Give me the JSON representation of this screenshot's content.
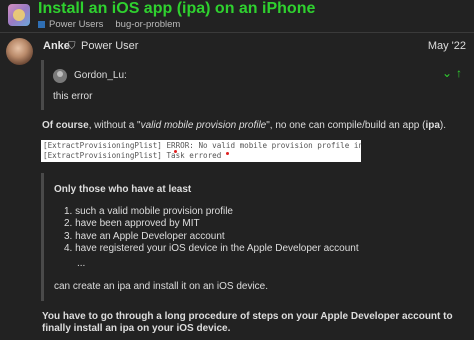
{
  "topic": {
    "title": "Install an iOS app (ipa) on an iPhone",
    "category": "Power Users",
    "tag": "bug-or-problem"
  },
  "post": {
    "author": "Anke",
    "author_title": "Power User",
    "date": "May '22",
    "quote": {
      "user": "Gordon_Lu:",
      "text": "this error",
      "icons": [
        "chevron-down-icon",
        "arrow-up-icon"
      ]
    },
    "para1": {
      "bold_lead": "Of course",
      "text_a": ", without a \"",
      "italic": "valid mobile provision profile",
      "text_b": "\", no one can compile/build an app (",
      "bold_ipa": "ipa",
      "text_c": ")."
    },
    "code_lines": [
      "[ExtractProvisioningPlist] ERROR: No valid mobile provision profile included in project",
      "[ExtractProvisioningPlist] Task errored"
    ],
    "quote2": {
      "title": "Only those who have at least",
      "items": [
        "1. such a valid mobile provision profile",
        "2. have been approved by MIT",
        "3. have an Apple Developer account",
        "4. have registered your iOS device in the Apple Developer account"
      ],
      "ellipsis": "...",
      "footer": "can create an ipa and install it on an iOS device."
    },
    "para2": "You have to go through a long procedure of steps on your Apple Developer account to finally install an ipa on your iOS device."
  },
  "colors": {
    "accent_green": "#2fd12f",
    "background": "#222222",
    "text": "#dddddd",
    "category_blue": "#2f6fb4"
  }
}
